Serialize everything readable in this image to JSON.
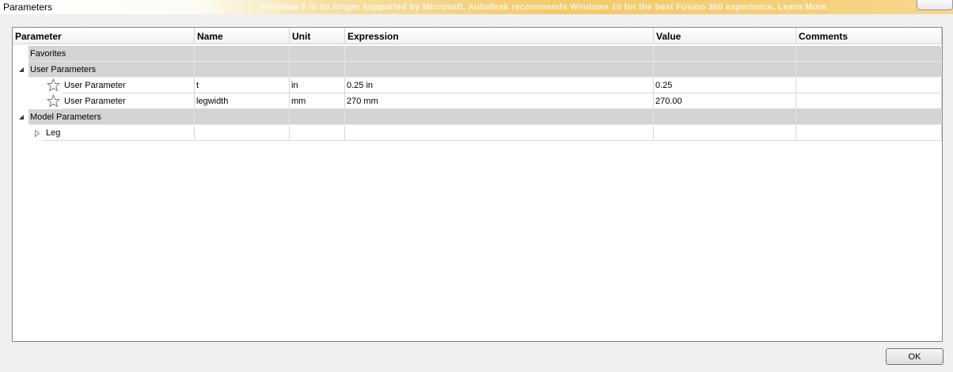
{
  "window": {
    "title": "Parameters",
    "notice": "Windows 7 is no longer supported by Microsoft. Autodesk recommends Windows 10 for the best Fusion 360 experience. Learn More"
  },
  "table": {
    "columns": [
      "Parameter",
      "Name",
      "Unit",
      "Expression",
      "Value",
      "Comments"
    ]
  },
  "groups": {
    "favorites": {
      "label": "Favorites"
    },
    "user": {
      "label": "User Parameters",
      "rows": [
        {
          "parameter": "User Parameter",
          "name": "t",
          "unit": "in",
          "expression": "0.25 in",
          "value": "0.25",
          "comments": ""
        },
        {
          "parameter": "User Parameter",
          "name": "legwidth",
          "unit": "mm",
          "expression": "270 mm",
          "value": "270.00",
          "comments": ""
        }
      ]
    },
    "model": {
      "label": "Model Parameters",
      "children": [
        {
          "label": "Leg"
        }
      ]
    }
  },
  "footer": {
    "ok_label": "OK"
  },
  "icons": {
    "expanded": "expanded-triangle-icon",
    "collapsed": "collapsed-triangle-icon",
    "add": "plus-icon",
    "favorite": "star-outline-icon"
  },
  "colors": {
    "group_row": "#d4d4d4",
    "title_gradient_end": "#f3c96a"
  }
}
